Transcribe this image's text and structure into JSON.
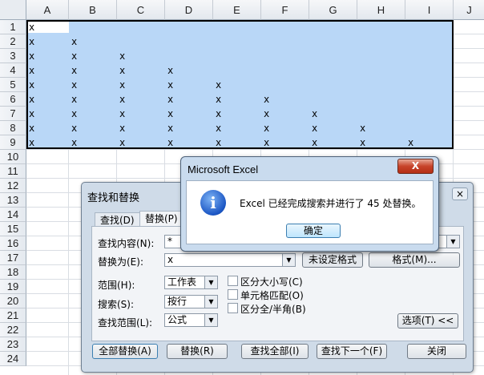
{
  "sheet": {
    "columns": [
      "A",
      "B",
      "C",
      "D",
      "E",
      "F",
      "G",
      "H",
      "I",
      "J"
    ],
    "rows": [
      "1",
      "2",
      "3",
      "4",
      "5",
      "6",
      "7",
      "8",
      "9",
      "10",
      "11",
      "12",
      "13",
      "14",
      "15",
      "16",
      "17",
      "18",
      "19",
      "20",
      "21",
      "22",
      "23",
      "24"
    ],
    "cell_value": "x"
  },
  "find_replace": {
    "title": "查找和替换",
    "close": "×",
    "tabs": [
      "查找(D)",
      "替换(P)"
    ],
    "find_label": "查找内容(N):",
    "find_value": "*",
    "replace_label": "替换为(E):",
    "replace_value": "x",
    "format_status": "未设定格式",
    "format_button": "格式(M)...",
    "within_label": "范围(H):",
    "within_value": "工作表",
    "search_label": "搜索(S):",
    "search_value": "按行",
    "lookin_label": "查找范围(L):",
    "lookin_value": "公式",
    "match_case": "区分大小写(C)",
    "match_entire": "单元格匹配(O)",
    "match_byte": "区分全/半角(B)",
    "options_button": "选项(T) <<",
    "replace_all": "全部替换(A)",
    "replace": "替换(R)",
    "find_all": "查找全部(I)",
    "find_next": "查找下一个(F)",
    "close_button": "关闭"
  },
  "message_box": {
    "title": "Microsoft Excel",
    "close": "X",
    "icon": "info-icon",
    "message": "Excel 已经完成搜索并进行了 45 处替换。",
    "ok": "确定"
  }
}
